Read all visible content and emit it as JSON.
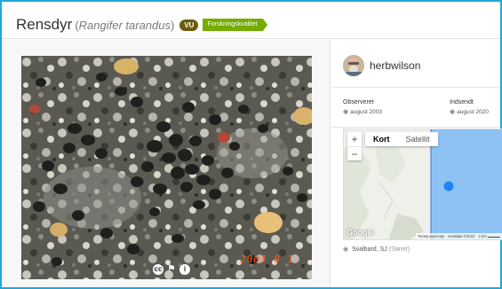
{
  "header": {
    "common_name": "Rensdyr",
    "scientific_prefix": "(",
    "scientific_name": "Rangifer tarandus",
    "scientific_suffix": ")",
    "status_badge": "VU",
    "quality_badge": "Forskningskvalitet"
  },
  "photo": {
    "date_stamp": "2003  8  1",
    "icons": [
      "cc-icon",
      "flag-icon",
      "info-icon"
    ]
  },
  "user": {
    "name": "herbwilson"
  },
  "dates": {
    "observed_label": "Observeret",
    "observed_value": "august 2003",
    "submitted_label": "Indsendt",
    "submitted_value": "august 2020"
  },
  "map": {
    "zoom_in": "+",
    "zoom_out": "−",
    "tab_map": "Kort",
    "tab_satellite": "Satellit",
    "google_logo": "Google",
    "attrib_shortcuts": "Tastaturgenveje",
    "attrib_mapdata": "Kortdata ©2022",
    "attrib_scale": "2 km",
    "colors": {
      "water": "#8fc2f4",
      "land": "#eef0ea",
      "marker": "#1f83f0",
      "boundary": "#3a6bd6"
    }
  },
  "place": {
    "name": "Svalbard, SJ",
    "obscured": "(Sløret)"
  },
  "colors": {
    "frame": "#22a8d8",
    "quality": "#74ac00",
    "vu": "#6b5b0e"
  }
}
